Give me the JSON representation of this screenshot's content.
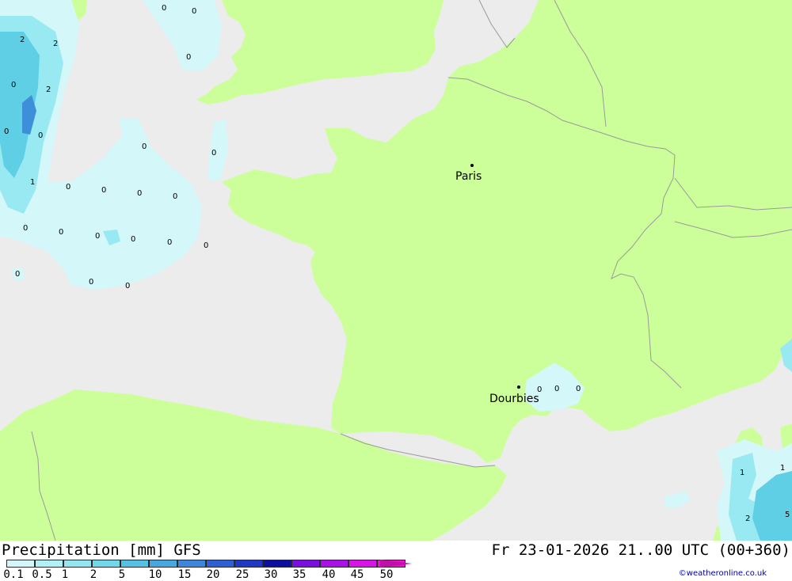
{
  "colors": {
    "sea": "#ececec",
    "land": "#ccff99",
    "border": "#9a9a9a",
    "precip_light": "#d4f7f9",
    "precip_mid": "#99e9f2",
    "precip_heavy": "#5fcfe6",
    "precip_strong": "#3c8fd8"
  },
  "cities": [
    {
      "name": "Paris"
    },
    {
      "name": "Dourbies"
    }
  ],
  "precip_labels": [
    "0",
    "0",
    "0",
    "2",
    "2",
    "0",
    "2",
    "0",
    "0",
    "0",
    "0",
    "1",
    "0",
    "0",
    "0",
    "0",
    "0",
    "0",
    "0",
    "0",
    "0",
    "0",
    "0",
    "0",
    "0",
    "0",
    "0",
    "0",
    "1",
    "1",
    "2",
    "5"
  ],
  "footer": {
    "title": "Precipitation [mm] GFS",
    "run_info": "Fr 23-01-2026 21..00 UTC (00+360)",
    "credit": "©weatheronline.co.uk"
  },
  "legend": {
    "ticks": [
      "0.1",
      "0.5",
      "1",
      "2",
      "5",
      "10",
      "15",
      "20",
      "25",
      "30",
      "35",
      "40",
      "45",
      "50"
    ],
    "colors": [
      "#d4f7f9",
      "#b3f0f5",
      "#93e6ef",
      "#72d8e8",
      "#56c1e3",
      "#4aa6df",
      "#3d86da",
      "#2f5fd2",
      "#2038c3",
      "#0e0ea0",
      "#7a10e0",
      "#a812e6",
      "#d814e6",
      "#ee10d0",
      "#c010a8"
    ]
  }
}
